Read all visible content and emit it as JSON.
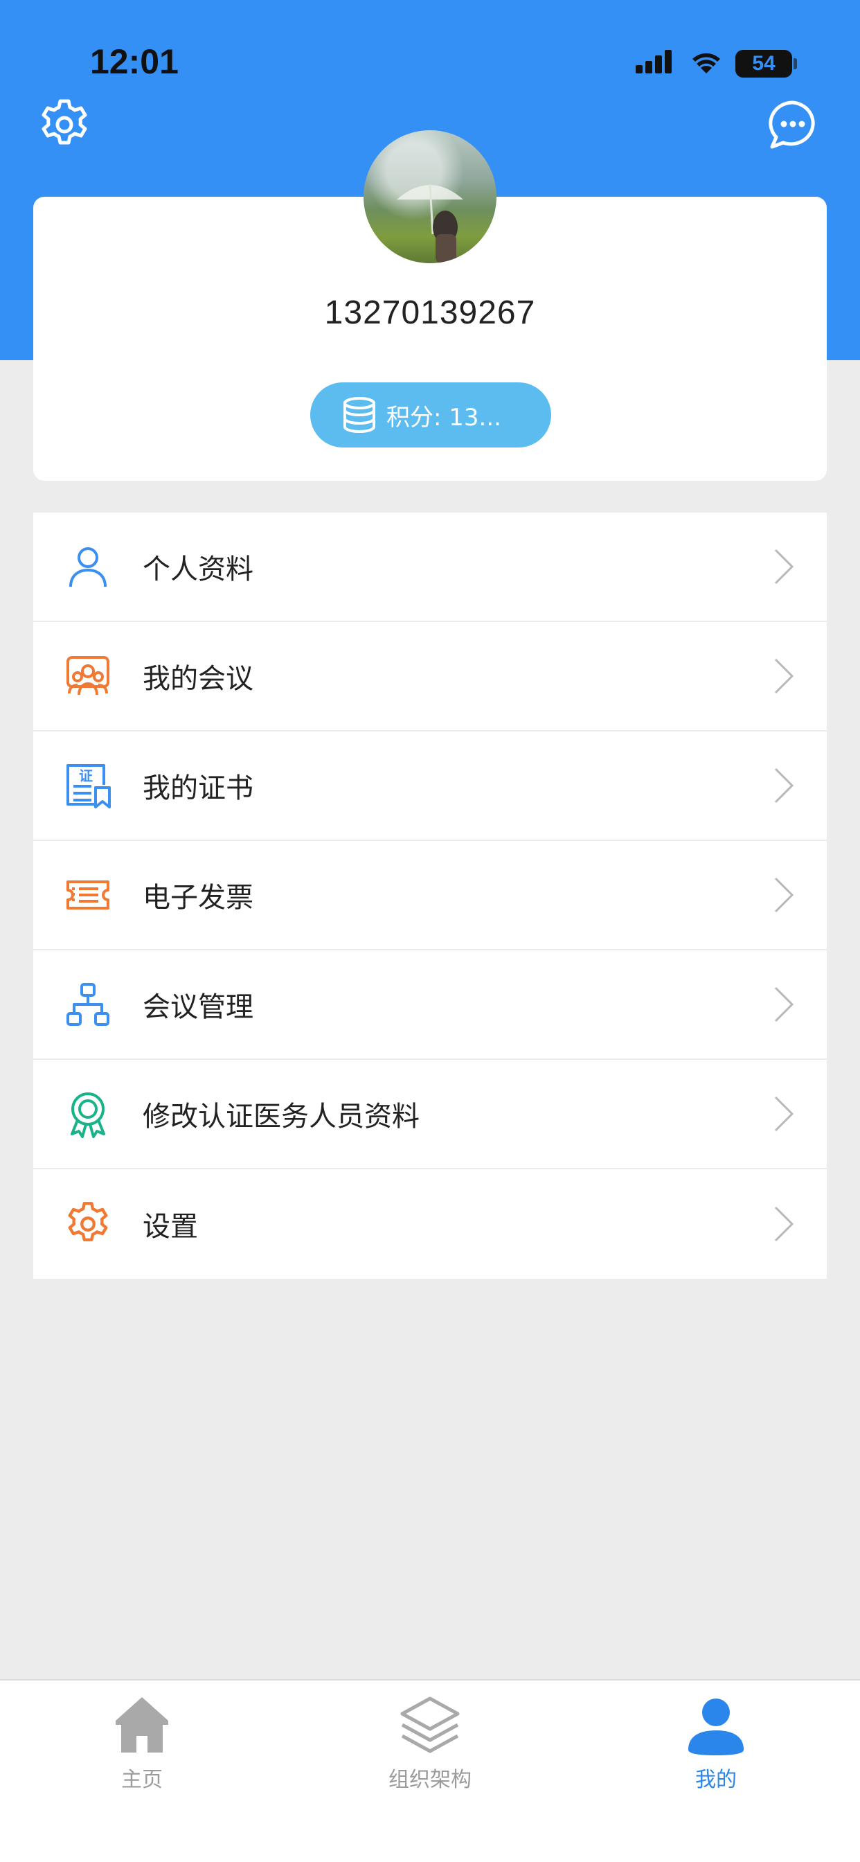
{
  "status_bar": {
    "time": "12:01",
    "battery": "54"
  },
  "profile": {
    "phone": "13270139267",
    "points_label": "积分: 13..."
  },
  "menu": [
    {
      "label": "个人资料",
      "icon": "person-icon",
      "color": "#3b8ff0"
    },
    {
      "label": "我的会议",
      "icon": "meeting-icon",
      "color": "#f07a34"
    },
    {
      "label": "我的证书",
      "icon": "certificate-icon",
      "color": "#3b8ff0"
    },
    {
      "label": "电子发票",
      "icon": "invoice-icon",
      "color": "#f07a34"
    },
    {
      "label": "会议管理",
      "icon": "org-chart-icon",
      "color": "#3b8ff0"
    },
    {
      "label": "修改认证医务人员资料",
      "icon": "badge-icon",
      "color": "#19b38a"
    },
    {
      "label": "设置",
      "icon": "gear-icon",
      "color": "#f07a34"
    }
  ],
  "tabbar": [
    {
      "label": "主页",
      "icon": "home-icon",
      "active": false
    },
    {
      "label": "组织架构",
      "icon": "layers-icon",
      "active": false
    },
    {
      "label": "我的",
      "icon": "user-icon",
      "active": true
    }
  ],
  "colors": {
    "header": "#3490f5",
    "points_pill": "#5cbcef",
    "active_tab": "#2a86ea",
    "background": "#ececec"
  }
}
